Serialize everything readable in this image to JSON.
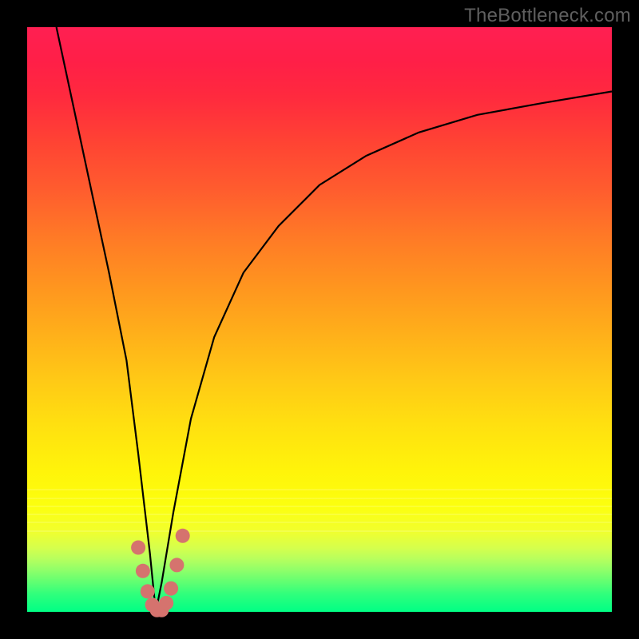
{
  "watermark": "TheBottleneck.com",
  "colors": {
    "frame": "#000000",
    "curve": "#000000",
    "dots": "#d5736e",
    "watermark": "#5f5f5f"
  },
  "chart_data": {
    "type": "line",
    "title": "",
    "xlabel": "",
    "ylabel": "",
    "xlim": [
      0,
      100
    ],
    "ylim": [
      0,
      100
    ],
    "grid": false,
    "legend": false,
    "note": "Unlabeled bottleneck V-curve. Vertical axis = bottleneck percentage (top = 100%, bottom = 0%). Background gradient encodes the same value (red high → green low). Minimum near x≈22 where bottleneck ≈ 0%. Values estimated from pixel positions.",
    "series": [
      {
        "name": "bottleneck-curve",
        "x": [
          5,
          8,
          11,
          14,
          17,
          19,
          21,
          22,
          23,
          25,
          28,
          32,
          37,
          43,
          50,
          58,
          67,
          77,
          88,
          100
        ],
        "y": [
          100,
          86,
          72,
          58,
          43,
          27,
          10,
          0,
          5,
          17,
          33,
          47,
          58,
          66,
          73,
          78,
          82,
          85,
          87,
          89
        ]
      }
    ],
    "highlight_dots": {
      "note": "Salmon dots marking the through/minimum region of the curve",
      "x": [
        19.0,
        19.8,
        20.6,
        21.4,
        22.2,
        23.0,
        23.8,
        24.6,
        25.6,
        26.6
      ],
      "y": [
        11,
        7,
        3.5,
        1.2,
        0.3,
        0.3,
        1.5,
        4,
        8,
        13
      ]
    }
  }
}
